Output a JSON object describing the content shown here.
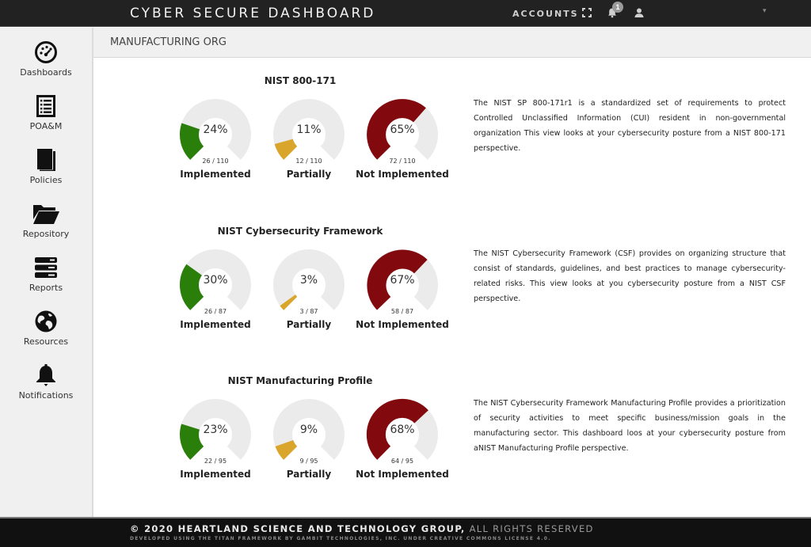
{
  "app": {
    "title": "CYBER SECURE DASHBOARD",
    "nav": {
      "accounts_label": "ACCOUNTS",
      "notification_count": "1"
    }
  },
  "sidebar": {
    "items": [
      {
        "label": "Dashboards",
        "icon": "dashboard-gauge-icon"
      },
      {
        "label": "POA&M",
        "icon": "list-document-icon"
      },
      {
        "label": "Policies",
        "icon": "book-icon"
      },
      {
        "label": "Repository",
        "icon": "folder-open-icon"
      },
      {
        "label": "Reports",
        "icon": "server-stack-icon"
      },
      {
        "label": "Resources",
        "icon": "globe-icon"
      },
      {
        "label": "Notifications",
        "icon": "bell-icon"
      }
    ]
  },
  "page": {
    "org_name": "MANUFACTURING ORG"
  },
  "colors": {
    "implemented": "#2a7f0a",
    "partially": "#d9a52b",
    "not_implemented": "#820a0e",
    "track": "#ebebeb"
  },
  "sections": [
    {
      "title": "NIST 800-171",
      "gauges": [
        {
          "label": "Implemented",
          "percent_text": "24%",
          "count_text": "26 / 110",
          "value": 26,
          "total": 110,
          "status": "implemented"
        },
        {
          "label": "Partially",
          "percent_text": "11%",
          "count_text": "12 / 110",
          "value": 12,
          "total": 110,
          "status": "partially"
        },
        {
          "label": "Not Implemented",
          "percent_text": "65%",
          "count_text": "72 / 110",
          "value": 72,
          "total": 110,
          "status": "not_implemented"
        }
      ],
      "description": "The NIST SP 800-171r1 is a standardized set of requirements to protect Controlled Unclassified Information (CUI) resident in non-governmental organization This view looks at your cybersecurity posture from a NIST 800-171 perspective."
    },
    {
      "title": "NIST Cybersecurity Framework",
      "gauges": [
        {
          "label": "Implemented",
          "percent_text": "30%",
          "count_text": "26 / 87",
          "value": 26,
          "total": 87,
          "status": "implemented"
        },
        {
          "label": "Partially",
          "percent_text": "3%",
          "count_text": "3 / 87",
          "value": 3,
          "total": 87,
          "status": "partially"
        },
        {
          "label": "Not Implemented",
          "percent_text": "67%",
          "count_text": "58 / 87",
          "value": 58,
          "total": 87,
          "status": "not_implemented"
        }
      ],
      "description": "The NIST Cybersecurity Framework (CSF) provides on organizing structure that consist of standards, guidelines, and best practices to manage cybersecurity-related risks. This view looks at you cybersecurity posture from a NIST CSF perspective."
    },
    {
      "title": "NIST Manufacturing Profile",
      "gauges": [
        {
          "label": "Implemented",
          "percent_text": "23%",
          "count_text": "22 / 95",
          "value": 22,
          "total": 95,
          "status": "implemented"
        },
        {
          "label": "Partially",
          "percent_text": "9%",
          "count_text": "9 / 95",
          "value": 9,
          "total": 95,
          "status": "partially"
        },
        {
          "label": "Not Implemented",
          "percent_text": "68%",
          "count_text": "64 / 95",
          "value": 64,
          "total": 95,
          "status": "not_implemented"
        }
      ],
      "description": "The NIST Cybersecurity Framework Manufacturing Profile provides a prioritization of security activities to meet specific business/mission goals in the manufacturing sector. This dashboard loos at your cybersecurity posture from aNIST Manufacturing Profile perspective."
    }
  ],
  "footer": {
    "copyright": "© 2020 HEARTLAND SCIENCE AND TECHNOLOGY GROUP,",
    "rights": " ALL RIGHTS RESERVED",
    "credit": "DEVELOPED USING THE TITAN FRAMEWORK BY GAMBIT TECHNOLOGIES, INC. UNDER CREATIVE COMMONS LICENSE 4.0."
  }
}
